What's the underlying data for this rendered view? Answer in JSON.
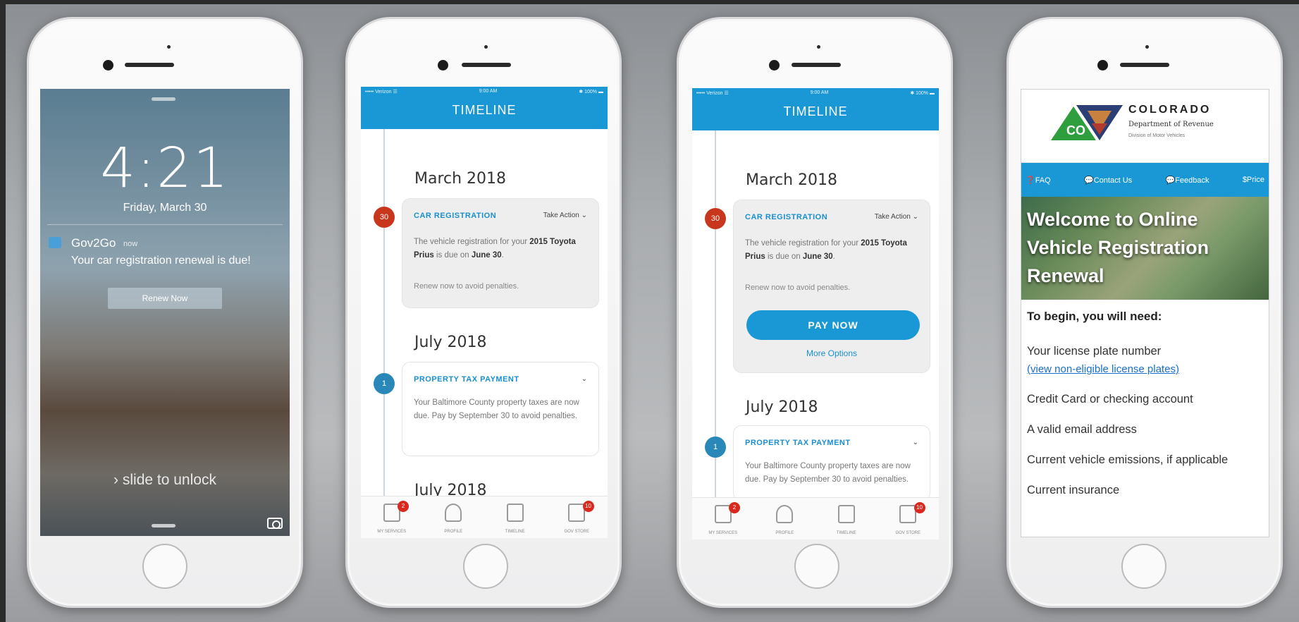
{
  "phone1": {
    "time": "4:21",
    "date": "Friday, March 30",
    "notification": {
      "app": "Gov2Go",
      "time": "now",
      "message": "Your car registration renewal is due!",
      "button": "Renew Now"
    },
    "slide_text": "› slide to unlock"
  },
  "timeline_common": {
    "status_left": "••••• Verizon ☰",
    "status_center": "9:00 AM",
    "status_right": "✱ 100% ▬",
    "nav_title": "TIMELINE",
    "tabs": [
      {
        "label": "MY SERVICES",
        "badge": "2"
      },
      {
        "label": "PROFILE",
        "badge": ""
      },
      {
        "label": "TIMELINE",
        "badge": ""
      },
      {
        "label": "GOV STORE",
        "badge": "10"
      }
    ]
  },
  "phone2": {
    "months": [
      "March 2018",
      "July 2018",
      "July 2018"
    ],
    "car_card": {
      "day": "30",
      "title": "CAR REGISTRATION",
      "action": "Take Action ⌄",
      "body_1": "The vehicle registration for your ",
      "body_bold_1": "2015 Toyota Prius",
      "body_2": " is due on ",
      "body_bold_2": "June 30",
      "body_3": ".",
      "note": "Renew now to avoid penalties."
    },
    "tax_card": {
      "day": "1",
      "title": "PROPERTY TAX PAYMENT",
      "action": "⌄",
      "body": "Your Baltimore County property taxes are now due. Pay by September 30 to avoid penalties."
    }
  },
  "phone3": {
    "months": [
      "March 2018",
      "July 2018"
    ],
    "pay_button": "PAY NOW",
    "more_options": "More Options"
  },
  "phone4": {
    "state": "COLORADO",
    "department": "Department of Revenue",
    "division": "Division of Motor Vehicles",
    "logo_text": "CO",
    "nav": [
      "❓FAQ",
      "💬Contact Us",
      "💬Feedback",
      "$Price"
    ],
    "hero": "Welcome to Online Vehicle Registration Renewal",
    "heading": "To begin, you will need:",
    "items": [
      "Your license plate number",
      "Credit Card or checking account",
      "A valid email address",
      "Current vehicle emissions, if applicable",
      "Current insurance"
    ],
    "plate_link": "(view non-eligible license plates)"
  },
  "colors": {
    "accent": "#1a97d5",
    "badge_red": "#d9291e",
    "dot_red": "#c9361e",
    "dot_blue": "#2a88b8"
  }
}
